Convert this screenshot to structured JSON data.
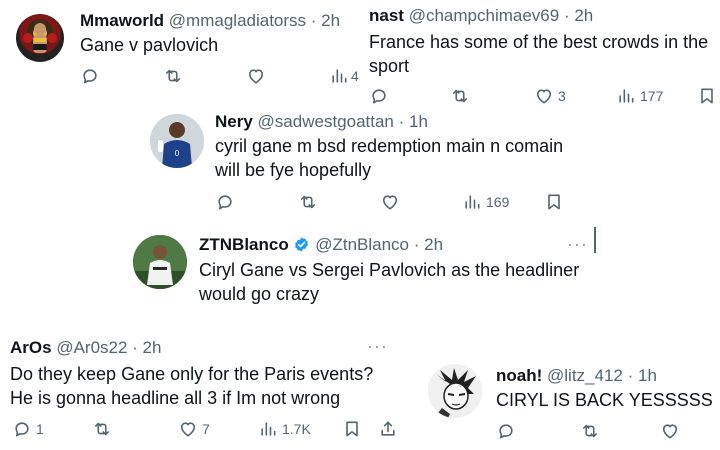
{
  "tweets": {
    "mmaworld": {
      "name": "Mmaworld",
      "handle": "@mmagladiatorss",
      "time": "· 2h",
      "text": "Gane v pavlovich",
      "views": "4"
    },
    "nast": {
      "name": "nast",
      "handle": "@champchimaev69",
      "time": "· 2h",
      "text_line1": "France has some of the best crowds in the",
      "text_line2": "sport",
      "likes": "3",
      "views": "177"
    },
    "nery": {
      "name": "Nery",
      "handle": "@sadwestgoattan",
      "time": "· 1h",
      "text_line1": "cyril gane m bsd redemption main n comain",
      "text_line2": "will be fye hopefully",
      "views": "169"
    },
    "ztnblanco": {
      "name": "ZTNBlanco",
      "handle": "@ZtnBlanco",
      "time": "· 2h",
      "more": "···",
      "text_line1": "Ciryl Gane vs Sergei Pavlovich as the headliner",
      "text_line2": "would go crazy"
    },
    "aros": {
      "name": "ArOs",
      "handle": "@Ar0s22",
      "time": "· 2h",
      "more": "···",
      "text_line1": "Do they keep Gane only for the Paris events?",
      "text_line2": "He is gonna headline all 3 if Im not wrong",
      "replies": "1",
      "likes": "7",
      "views": "1.7K"
    },
    "noah": {
      "name": "noah!",
      "handle": "@litz_412",
      "time": "· 1h",
      "text": "CIRYL IS BACK YESSSSS"
    }
  },
  "colors": {
    "text": "#0f1419",
    "muted": "#536471",
    "verified": "#1d9bf0"
  }
}
